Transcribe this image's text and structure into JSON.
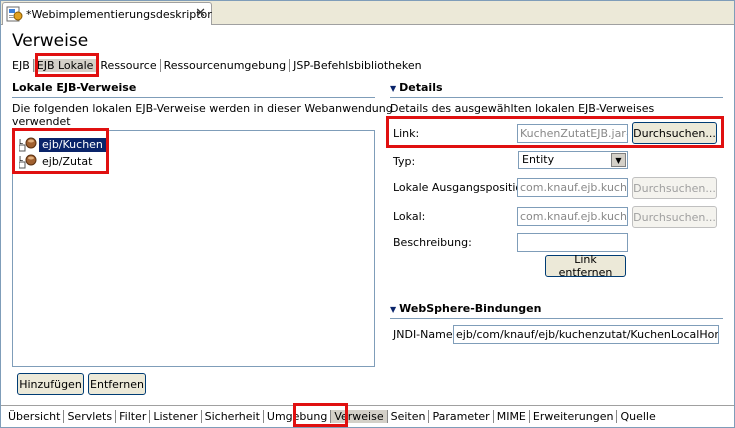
{
  "editor_tab": {
    "title": "*Webimplementierungsdeskriptor",
    "close": "✕"
  },
  "page_title": "Verweise",
  "top_tabs": [
    "EJB",
    "EJB Lokale",
    "Ressource",
    "Ressourcenumgebung",
    "JSP-Befehlsbibliotheken"
  ],
  "left": {
    "heading": "Lokale EJB-Verweise",
    "description_line1": "Die folgenden lokalen EJB-Verweise werden in dieser Webanwendung",
    "description_line2": "verwendet",
    "items": [
      "ejb/Kuchen",
      "ejb/Zutat"
    ],
    "add_button": "Hinzufügen",
    "remove_button": "Entfernen"
  },
  "details": {
    "heading": "Details",
    "description": "Details des ausgewählten lokalen EJB-Verweises",
    "link_label": "Link:",
    "link_value": "KuchenZutatEJB.jar#",
    "browse_label": "Durchsuchen...",
    "type_label": "Typ:",
    "type_value": "Entity",
    "local_home_label": "Lokale Ausgangsposition:",
    "local_home_value": "com.knauf.ejb.kuche",
    "local_label": "Lokal:",
    "local_value": "com.knauf.ejb.kuche",
    "description_label": "Beschreibung:",
    "remove_link_button": "Link entfernen"
  },
  "websphere": {
    "heading": "WebSphere-Bindungen",
    "jndi_label": "JNDI-Name:",
    "jndi_value": "ejb/com/knauf/ejb/kuchenzutat/KuchenLocalHome"
  },
  "bottom_tabs": [
    "Übersicht",
    "Servlets",
    "Filter",
    "Listener",
    "Sicherheit",
    "Umgebung",
    "Verweise",
    "Seiten",
    "Parameter",
    "MIME",
    "Erweiterungen",
    "Quelle"
  ],
  "colors": {
    "highlight": "#e01010",
    "selection": "#0a246a",
    "border": "#7f9db9"
  }
}
